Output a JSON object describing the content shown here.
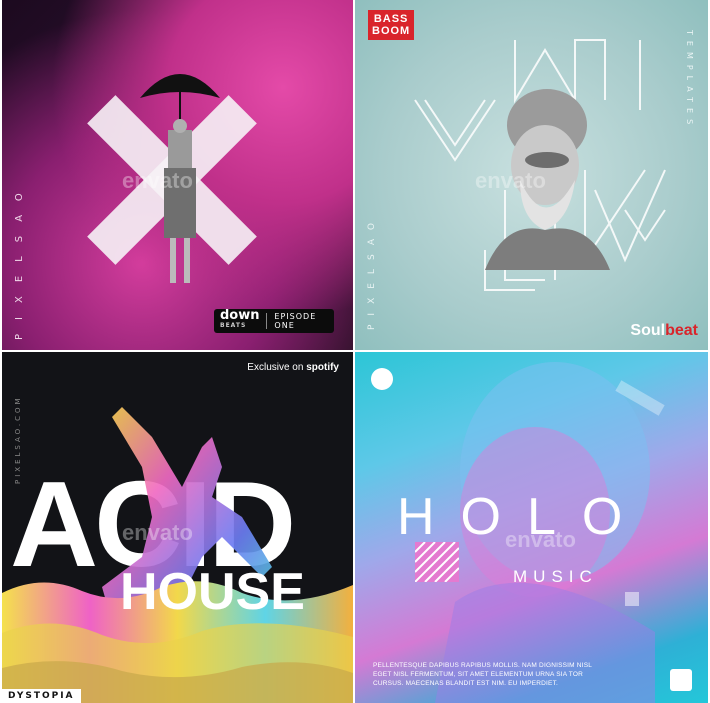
{
  "tiles": {
    "downbeats": {
      "vertical_text": "PIXELSAO",
      "badge_brand": "down",
      "badge_sub": "BEATS",
      "badge_episode": "EPISODE ONE",
      "watermark": "envato"
    },
    "soulbeat": {
      "badge_line1": "BASS",
      "badge_line2": "BOOM",
      "vertical_left": "PIXELSAO",
      "vertical_right": "TEMPLATES",
      "brand_white": "Soul",
      "brand_red": "beat",
      "watermark": "envato"
    },
    "acid_house": {
      "exclusive_prefix": "Exclusive on",
      "exclusive_brand": "spotify",
      "vertical_text": "PIXELSAO.COM",
      "title_line1": "ACID",
      "title_line2": "HOUSE",
      "corner_tag": "DYSTOPIA",
      "watermark": "envato"
    },
    "holo_music": {
      "title": "HOLO",
      "subtitle": "MUSIC",
      "body_text": "PELLENTESQUE DAPIBUS RAPIBUS MOLLIS. NAM DIGNISSIM NISL EGET NISL FERMENTUM, SIT AMET ELEMENTUM URNA SIA TOR CURSUS. MAECENAS BLANDIT EST NIM. EU IMPERDIET.",
      "watermark": "envato"
    }
  },
  "colors": {
    "pink": "#d43d9d",
    "mint": "#a9cccc",
    "red": "#d9242b",
    "dark": "#121317",
    "cyan": "#2cc6d6"
  }
}
